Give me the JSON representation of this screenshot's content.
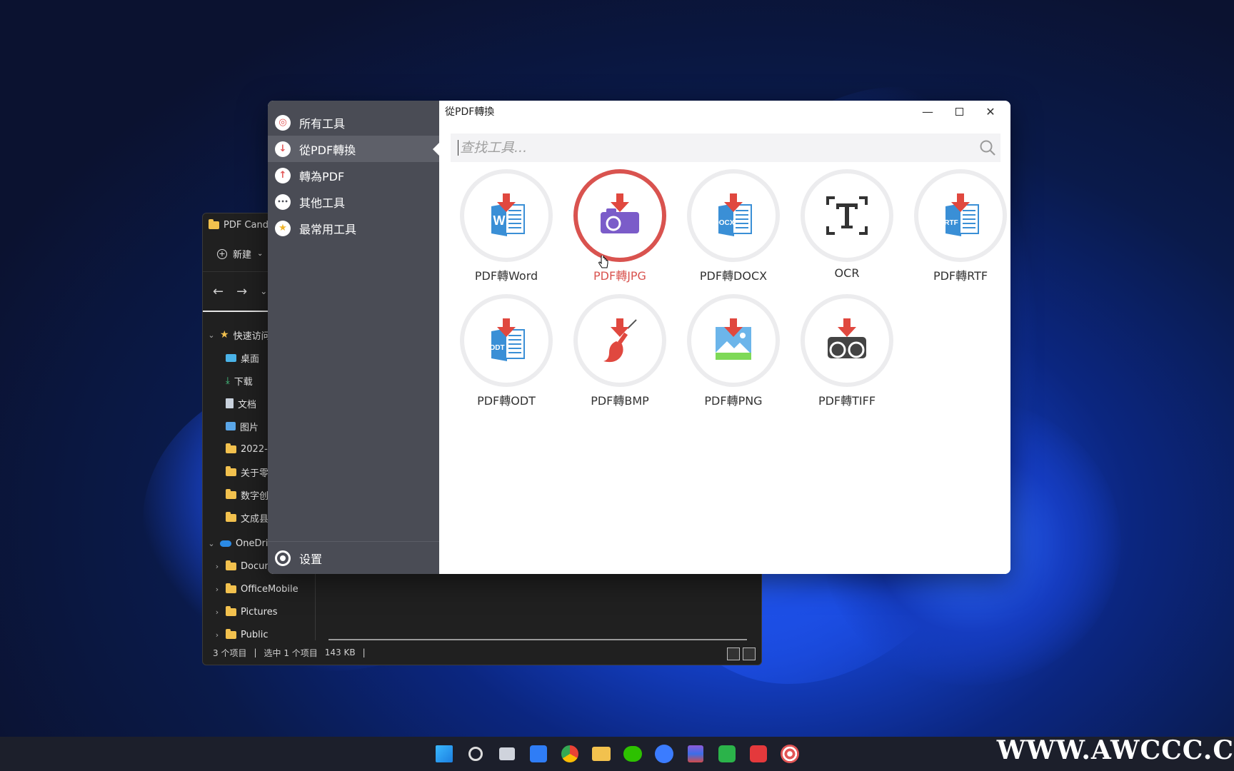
{
  "explorer": {
    "title": "PDF Candy",
    "new_label": "新建",
    "tree": [
      {
        "label": "快速访问",
        "kind": "star",
        "level": 0,
        "expanded": true
      },
      {
        "label": "桌面",
        "kind": "desktop",
        "level": 1
      },
      {
        "label": "下载",
        "kind": "download",
        "level": 1
      },
      {
        "label": "文档",
        "kind": "doc",
        "level": 1
      },
      {
        "label": "图片",
        "kind": "picture",
        "level": 1
      },
      {
        "label": "2022-",
        "kind": "folder",
        "level": 1
      },
      {
        "label": "关于零",
        "kind": "folder",
        "level": 1
      },
      {
        "label": "数字创",
        "kind": "folder",
        "level": 1
      },
      {
        "label": "文成县",
        "kind": "folder",
        "level": 1
      },
      {
        "label": "OneDri",
        "kind": "cloud",
        "level": 0,
        "expanded": true
      },
      {
        "label": "Docun",
        "kind": "folder",
        "level": 1
      },
      {
        "label": "OfficeMobile",
        "kind": "folder",
        "level": 1
      },
      {
        "label": "Pictures",
        "kind": "folder",
        "level": 1
      },
      {
        "label": "Public",
        "kind": "folder",
        "level": 1
      }
    ],
    "status": {
      "items": "3 个项目",
      "selected": "选中 1 个项目",
      "size": "143 KB"
    }
  },
  "app": {
    "sidebar": {
      "items": [
        {
          "label": "所有工具",
          "icon": "candy-icon"
        },
        {
          "label": "從PDF轉換",
          "icon": "arrow-down-icon",
          "active": true
        },
        {
          "label": "轉為PDF",
          "icon": "arrow-up-icon"
        },
        {
          "label": "其他工具",
          "icon": "dots-icon"
        },
        {
          "label": "最常用工具",
          "icon": "star-icon"
        }
      ],
      "settings_label": "设置"
    },
    "title": "從PDF轉換",
    "search": {
      "placeholder": "查找工具..."
    },
    "tools": [
      {
        "label": "PDF轉Word",
        "icon": "word-icon",
        "badge": "W"
      },
      {
        "label": "PDF轉JPG",
        "icon": "jpg-icon",
        "hover": true
      },
      {
        "label": "PDF轉DOCX",
        "icon": "docx-icon",
        "badge": "DOCX"
      },
      {
        "label": "OCR",
        "icon": "ocr-icon",
        "badge": "T"
      },
      {
        "label": "PDF轉RTF",
        "icon": "rtf-icon",
        "badge": "RTF"
      },
      {
        "label": "PDF轉ODT",
        "icon": "odt-icon",
        "badge": "ODT"
      },
      {
        "label": "PDF轉BMP",
        "icon": "bmp-icon"
      },
      {
        "label": "PDF轉PNG",
        "icon": "png-icon"
      },
      {
        "label": "PDF轉TIFF",
        "icon": "tiff-icon"
      }
    ],
    "colors": {
      "accent": "#d9534f",
      "sidebar": "#4a4c55",
      "sidebar_active": "#5e6069",
      "doc_blue": "#3a8fd6"
    }
  },
  "taskbar": {
    "icons": [
      "windows-start-icon",
      "search-icon",
      "task-view-icon",
      "todo-icon",
      "chrome-icon",
      "file-explorer-icon",
      "wechat-icon",
      "feishu-icon",
      "winrar-icon",
      "camtasia-icon",
      "wps-icon",
      "pdf-candy-icon"
    ]
  },
  "watermark": "WWW.AWCCC.C"
}
